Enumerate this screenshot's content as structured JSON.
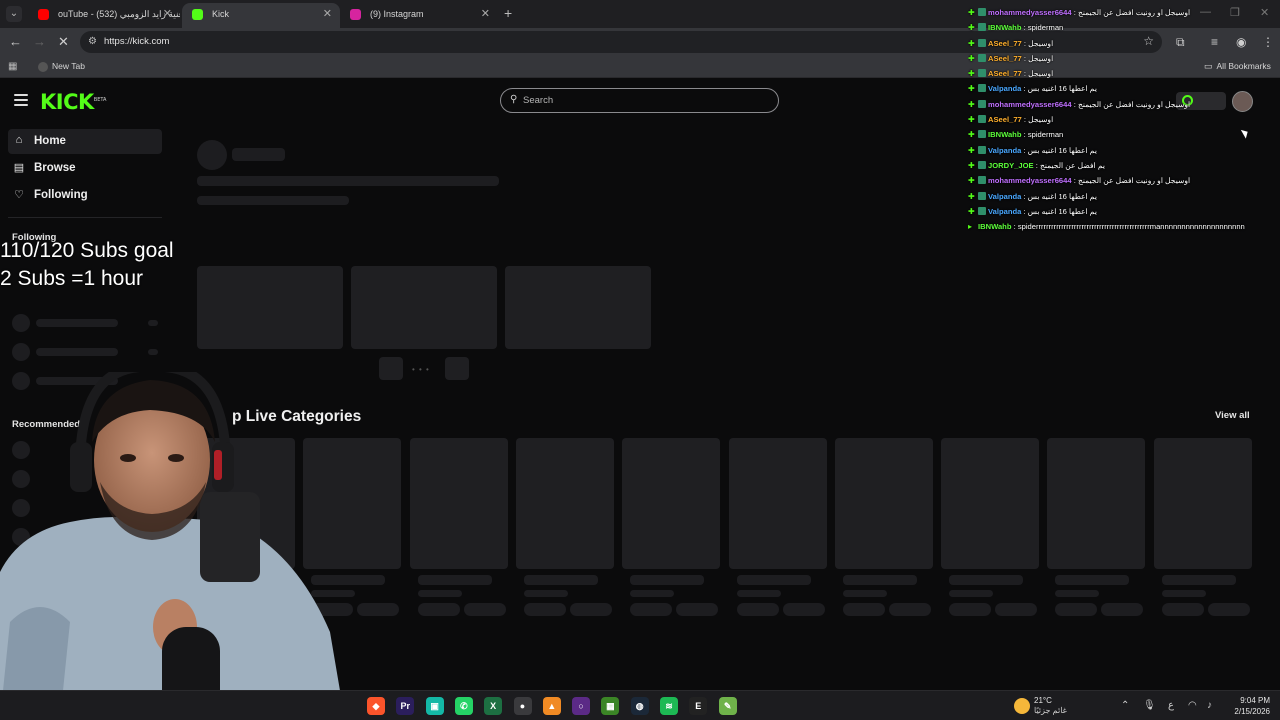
{
  "browser": {
    "tabs": [
      {
        "label": "ouTube - اغنية زايد الزومبي (532)",
        "favicon_color": "#ff0000",
        "active": false
      },
      {
        "label": "Kick",
        "favicon_color": "#53fc18",
        "active": true
      },
      {
        "label": "(9) Instagram",
        "favicon_color": "#d6249f",
        "active": false
      }
    ],
    "url": "https://kick.com",
    "bookmarks": {
      "new_tab": "New Tab",
      "all_bookmarks": "All Bookmarks"
    }
  },
  "kick": {
    "logo": "KICK",
    "logo_badge": "BETA",
    "search_placeholder": "Search",
    "sidebar": {
      "items": [
        {
          "label": "Home",
          "icon": "home-icon"
        },
        {
          "label": "Browse",
          "icon": "browse-icon"
        },
        {
          "label": "Following",
          "icon": "heart-icon"
        }
      ],
      "following_heading": "Following",
      "recommended_heading": "Recommended"
    },
    "section_title": "Top Live Categories",
    "section_title_visible": "p Live Categories",
    "view_all": "View all"
  },
  "overlay": {
    "goal_line1": "110/120 Subs goal",
    "goal_line2": "2 Subs =1 hour"
  },
  "chat": [
    {
      "user": "mohammedyasser6644",
      "color": "#c070ff",
      "msg": "اوسيجل او رونيت افضل عن الجيمنج"
    },
    {
      "user": "IBNWahb",
      "color": "#5dff3b",
      "msg": "spiderman"
    },
    {
      "user": "ASeel_77",
      "color": "#ffb02e",
      "msg": "اوسيجل"
    },
    {
      "user": "ASeel_77",
      "color": "#ffb02e",
      "msg": "اوسيجل"
    },
    {
      "user": "ASeel_77",
      "color": "#ffb02e",
      "msg": "اوسيجل"
    },
    {
      "user": "Valpanda",
      "color": "#4aa8ff",
      "msg": "يم اعطها 16 اغنيه بس"
    },
    {
      "user": "mohammedyasser6644",
      "color": "#c070ff",
      "msg": "اوسيجل او رونيت افضل عن الجيمنج"
    },
    {
      "user": "ASeel_77",
      "color": "#ffb02e",
      "msg": "اوسيجل"
    },
    {
      "user": "IBNWahb",
      "color": "#5dff3b",
      "msg": "spiderman"
    },
    {
      "user": "Valpanda",
      "color": "#4aa8ff",
      "msg": "يم اعطها 16 اغنيه بس"
    },
    {
      "user": "JORDY_JOE",
      "color": "#5dff3b",
      "msg": "يم افضل عن الجيمنج"
    },
    {
      "user": "mohammedyasser6644",
      "color": "#c070ff",
      "msg": "اوسيجل او رونيت افضل عن الجيمنج"
    },
    {
      "user": "Valpanda",
      "color": "#4aa8ff",
      "msg": "يم اعطها 16 اغنيه بس"
    },
    {
      "user": "Valpanda",
      "color": "#4aa8ff",
      "msg": "يم اعطها 16 اغنيه بس"
    },
    {
      "user": "IBNWahb",
      "color": "#5dff3b",
      "msg": "spiderrrrrrrrrrrrrrrrrrrrrrrrrrrrrrrrrrrrrrrrrrrrrmannnnnnnnnnnnnnnnnnnn"
    }
  ],
  "taskbar": {
    "weather_temp": "21°C",
    "weather_desc": "غائم جزئيًا",
    "weather_badge": "1",
    "time": "9:04 PM",
    "date": "2/15/2026",
    "lang": "ع",
    "apps": [
      {
        "name": "brave-icon",
        "glyph": "◆",
        "color": "#fb542b"
      },
      {
        "name": "premiere-icon",
        "glyph": "Pr",
        "color": "#2b1e5c"
      },
      {
        "name": "app-icon",
        "glyph": "▣",
        "color": "#14b8a6"
      },
      {
        "name": "whatsapp-icon",
        "glyph": "✆",
        "color": "#25d366"
      },
      {
        "name": "excel-icon",
        "glyph": "X",
        "color": "#1d6f42"
      },
      {
        "name": "chrome-icon",
        "glyph": "●",
        "color": "#3a3a3d"
      },
      {
        "name": "vlc-icon",
        "glyph": "▲",
        "color": "#f08a24"
      },
      {
        "name": "obs-icon",
        "glyph": "○",
        "color": "#5b2a86"
      },
      {
        "name": "minecraft-icon",
        "glyph": "▦",
        "color": "#3b8526"
      },
      {
        "name": "steam-icon",
        "glyph": "◍",
        "color": "#1b2838"
      },
      {
        "name": "spotify-icon",
        "glyph": "≋",
        "color": "#1db954"
      },
      {
        "name": "epic-icon",
        "glyph": "E",
        "color": "#222"
      },
      {
        "name": "notepad-icon",
        "glyph": "✎",
        "color": "#6fb24a"
      }
    ]
  }
}
